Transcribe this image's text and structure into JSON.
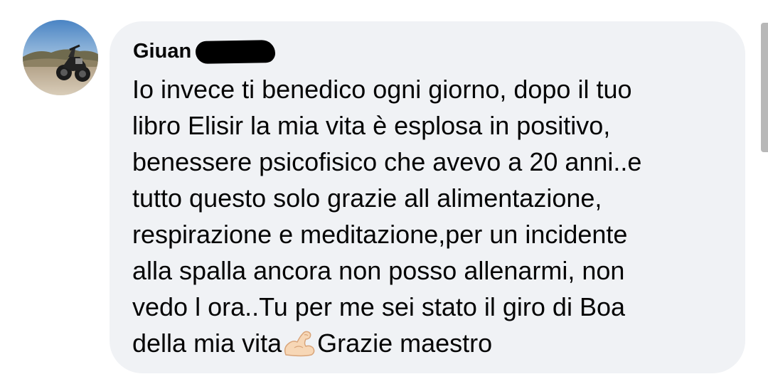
{
  "comment": {
    "author": {
      "name": "Giuan",
      "name_redacted": true,
      "avatar": "motorcycle-photo"
    },
    "text_lines": [
      "Io invece ti benedico ogni giorno, dopo il tuo",
      "libro Elisir la mia vita è esplosa in positivo,",
      "benessere psicofisico che avevo a 20 anni..e",
      "tutto questo solo grazie all alimentazione,",
      "respirazione e meditazione,per un incidente",
      "alla spalla ancora non posso allenarmi, non",
      "vedo l ora..Tu per me sei stato il giro di Boa"
    ],
    "last_line": {
      "before_emoji": "della mia vita",
      "emoji": "flexed-biceps-emoji",
      "after_emoji": "Grazie maestro"
    }
  },
  "colors": {
    "bubble_background": "#f0f2f5",
    "text": "#050505",
    "page_background": "#ffffff"
  }
}
